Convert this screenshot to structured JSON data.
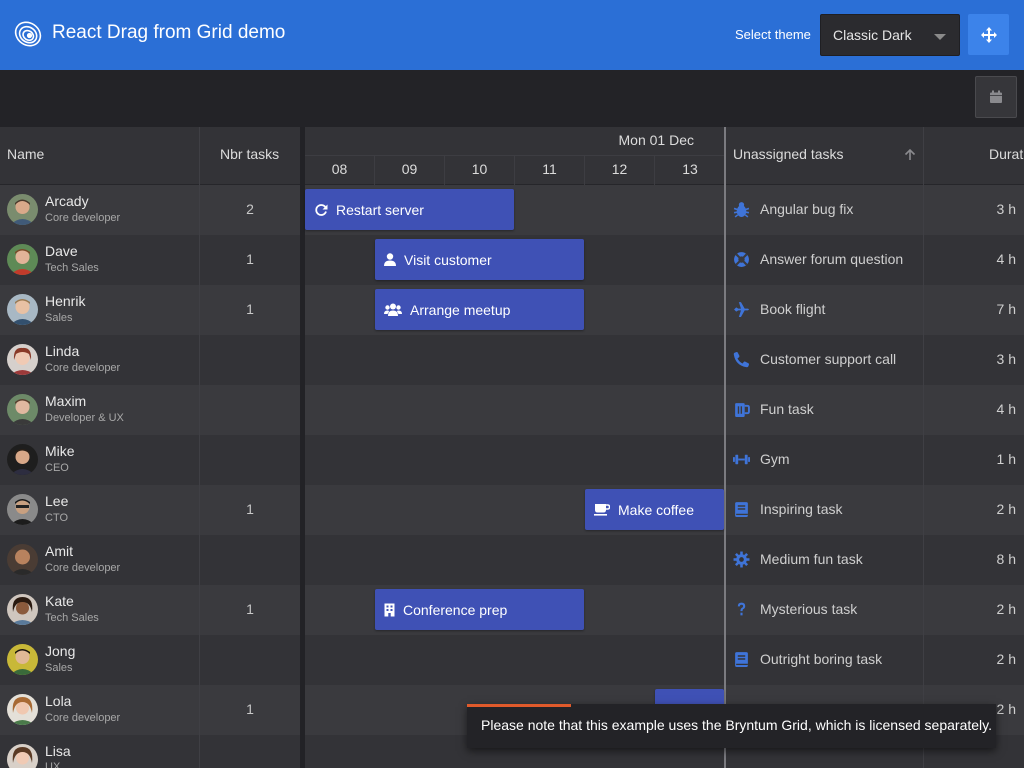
{
  "header": {
    "title": "React Drag from Grid demo",
    "theme_label": "Select theme",
    "theme_value": "Classic Dark",
    "accent": "#2b6fd6",
    "move_icon": "arrows-move-icon"
  },
  "toolbar": {
    "calendar_icon": "calendar-icon"
  },
  "columns": {
    "name": "Name",
    "nbr_tasks": "Nbr tasks",
    "date": "Mon 01 Dec",
    "hours": [
      "08",
      "09",
      "10",
      "11",
      "12",
      "13"
    ],
    "unassigned": "Unassigned tasks",
    "duration": "Duration"
  },
  "resources": [
    {
      "name": "Arcady",
      "role": "Core developer",
      "tasks": "2"
    },
    {
      "name": "Dave",
      "role": "Tech Sales",
      "tasks": "1"
    },
    {
      "name": "Henrik",
      "role": "Sales",
      "tasks": "1"
    },
    {
      "name": "Linda",
      "role": "Core developer",
      "tasks": ""
    },
    {
      "name": "Maxim",
      "role": "Developer & UX",
      "tasks": ""
    },
    {
      "name": "Mike",
      "role": "CEO",
      "tasks": ""
    },
    {
      "name": "Lee",
      "role": "CTO",
      "tasks": "1"
    },
    {
      "name": "Amit",
      "role": "Core developer",
      "tasks": ""
    },
    {
      "name": "Kate",
      "role": "Tech Sales",
      "tasks": "1"
    },
    {
      "name": "Jong",
      "role": "Sales",
      "tasks": ""
    },
    {
      "name": "Lola",
      "role": "Core developer",
      "tasks": "1"
    },
    {
      "name": "Lisa",
      "role": "UX",
      "tasks": ""
    }
  ],
  "events": [
    {
      "name": "Restart server",
      "icon": "refresh-icon"
    },
    {
      "name": "Visit customer",
      "icon": "user-icon"
    },
    {
      "name": "Arrange meetup",
      "icon": "users-icon"
    },
    {
      "name": "Make coffee",
      "icon": "coffee-icon"
    },
    {
      "name": "Conference prep",
      "icon": "building-icon"
    },
    {
      "name": "",
      "icon": ""
    }
  ],
  "unassigned": [
    {
      "name": "Angular bug fix",
      "duration": "3 h",
      "icon": "bug-icon"
    },
    {
      "name": "Answer forum question",
      "duration": "4 h",
      "icon": "life-ring-icon"
    },
    {
      "name": "Book flight",
      "duration": "7 h",
      "icon": "plane-icon"
    },
    {
      "name": "Customer support call",
      "duration": "3 h",
      "icon": "phone-icon"
    },
    {
      "name": "Fun task",
      "duration": "4 h",
      "icon": "beer-icon"
    },
    {
      "name": "Gym",
      "duration": "1 h",
      "icon": "dumbbell-icon"
    },
    {
      "name": "Inspiring task",
      "duration": "2 h",
      "icon": "book-icon"
    },
    {
      "name": "Medium fun task",
      "duration": "8 h",
      "icon": "gear-icon"
    },
    {
      "name": "Mysterious task",
      "duration": "2 h",
      "icon": "question-icon"
    },
    {
      "name": "Outright boring task",
      "duration": "2 h",
      "icon": "book-icon"
    },
    {
      "name": "",
      "duration": "2 h",
      "icon": ""
    }
  ],
  "toast": {
    "message": "Please note that this example uses the Bryntum Grid, which is licensed separately."
  },
  "colors": {
    "event": "#3f51b5",
    "task_icon": "#3f74d8",
    "toast_progress": "#e05a2b"
  }
}
